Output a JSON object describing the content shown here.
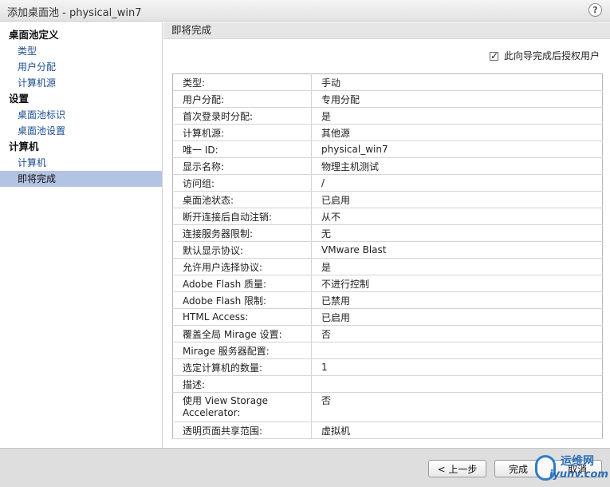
{
  "window": {
    "title": "添加桌面池 - physical_win7",
    "help_label": "?"
  },
  "sidebar": {
    "groups": [
      {
        "label": "桌面池定义",
        "items": [
          "类型",
          "用户分配",
          "计算机源"
        ]
      },
      {
        "label": "设置",
        "items": [
          "桌面池标识",
          "桌面池设置"
        ]
      },
      {
        "label": "计算机",
        "items": [
          "计算机",
          "即将完成"
        ]
      }
    ],
    "active_item": "即将完成"
  },
  "main": {
    "header": "即将完成",
    "authorize_checkbox": {
      "label": "此向导完成后授权用户",
      "checked": true
    },
    "summary": [
      {
        "key": "类型:",
        "value": "手动"
      },
      {
        "key": "用户分配:",
        "value": "专用分配"
      },
      {
        "key": "首次登录时分配:",
        "value": "是"
      },
      {
        "key": "计算机源:",
        "value": "其他源"
      },
      {
        "key": "唯一 ID:",
        "value": "physical_win7"
      },
      {
        "key": "显示名称:",
        "value": "物理主机测试"
      },
      {
        "key": "访问组:",
        "value": "/"
      },
      {
        "key": "桌面池状态:",
        "value": "已启用"
      },
      {
        "key": "断开连接后自动注销:",
        "value": "从不"
      },
      {
        "key": "连接服务器限制:",
        "value": "无"
      },
      {
        "key": "默认显示协议:",
        "value": "VMware Blast"
      },
      {
        "key": "允许用户选择协议:",
        "value": "是"
      },
      {
        "key": "Adobe Flash 质量:",
        "value": "不进行控制"
      },
      {
        "key": "Adobe Flash 限制:",
        "value": "已禁用"
      },
      {
        "key": "HTML Access:",
        "value": "已启用"
      },
      {
        "key": "覆盖全局 Mirage 设置:",
        "value": "否"
      },
      {
        "key": "Mirage 服务器配置:",
        "value": ""
      },
      {
        "key": "选定计算机的数量:",
        "value": "1"
      },
      {
        "key": "描述:",
        "value": ""
      },
      {
        "key": "使用 View Storage Accelerator:",
        "value": "否"
      },
      {
        "key": "透明页面共享范围:",
        "value": "虚拟机"
      }
    ]
  },
  "footer": {
    "back_label": "< 上一步",
    "finish_label": "完成",
    "cancel_label": "取消"
  },
  "watermark": {
    "cn": "运维网",
    "en": "iyunv.com"
  },
  "colors": {
    "active_nav": "#b2c3e3",
    "link": "#1e4d8f",
    "header_bg": "#e6e6e6"
  }
}
